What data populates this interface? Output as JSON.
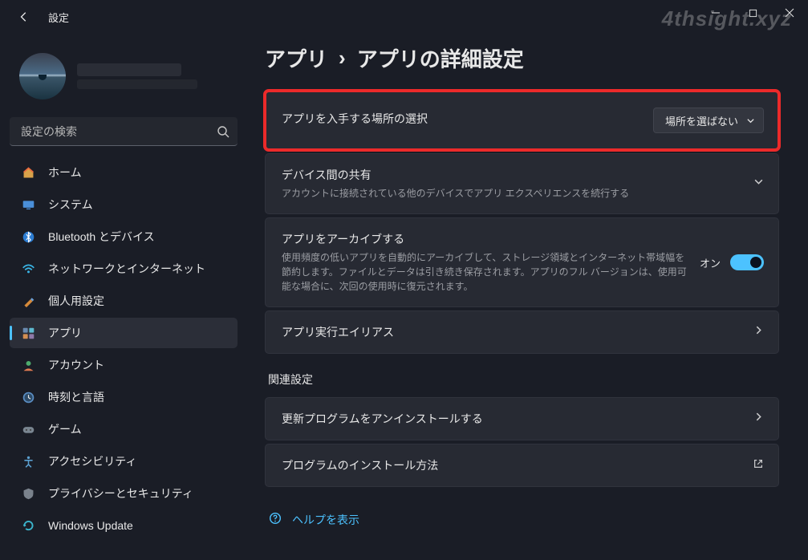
{
  "watermark": "4thsight.xyz",
  "titlebar": {
    "title": "設定"
  },
  "search": {
    "placeholder": "設定の検索"
  },
  "sidebar": {
    "items": [
      {
        "label": "ホーム",
        "icon": "home"
      },
      {
        "label": "システム",
        "icon": "system"
      },
      {
        "label": "Bluetooth とデバイス",
        "icon": "bluetooth"
      },
      {
        "label": "ネットワークとインターネット",
        "icon": "network"
      },
      {
        "label": "個人用設定",
        "icon": "personalize"
      },
      {
        "label": "アプリ",
        "icon": "apps",
        "active": true
      },
      {
        "label": "アカウント",
        "icon": "accounts"
      },
      {
        "label": "時刻と言語",
        "icon": "time"
      },
      {
        "label": "ゲーム",
        "icon": "gaming"
      },
      {
        "label": "アクセシビリティ",
        "icon": "accessibility"
      },
      {
        "label": "プライバシーとセキュリティ",
        "icon": "privacy"
      },
      {
        "label": "Windows Update",
        "icon": "update"
      }
    ]
  },
  "breadcrumb": {
    "parent": "アプリ",
    "separator": "›",
    "current": "アプリの詳細設定"
  },
  "cards": {
    "source": {
      "title": "アプリを入手する場所の選択",
      "selected": "場所を選ばない"
    },
    "share": {
      "title": "デバイス間の共有",
      "desc": "アカウントに接続されている他のデバイスでアプリ エクスペリエンスを続行する"
    },
    "archive": {
      "title": "アプリをアーカイブする",
      "desc": "使用頻度の低いアプリを自動的にアーカイブして、ストレージ領域とインターネット帯域幅を節約します。ファイルとデータは引き続き保存されます。アプリのフル バージョンは、使用可能な場合に、次回の使用時に復元されます。",
      "toggle_label": "オン"
    },
    "alias": {
      "title": "アプリ実行エイリアス"
    },
    "related_label": "関連設定",
    "uninstall": {
      "title": "更新プログラムをアンインストールする"
    },
    "install": {
      "title": "プログラムのインストール方法"
    },
    "help": "ヘルプを表示"
  }
}
